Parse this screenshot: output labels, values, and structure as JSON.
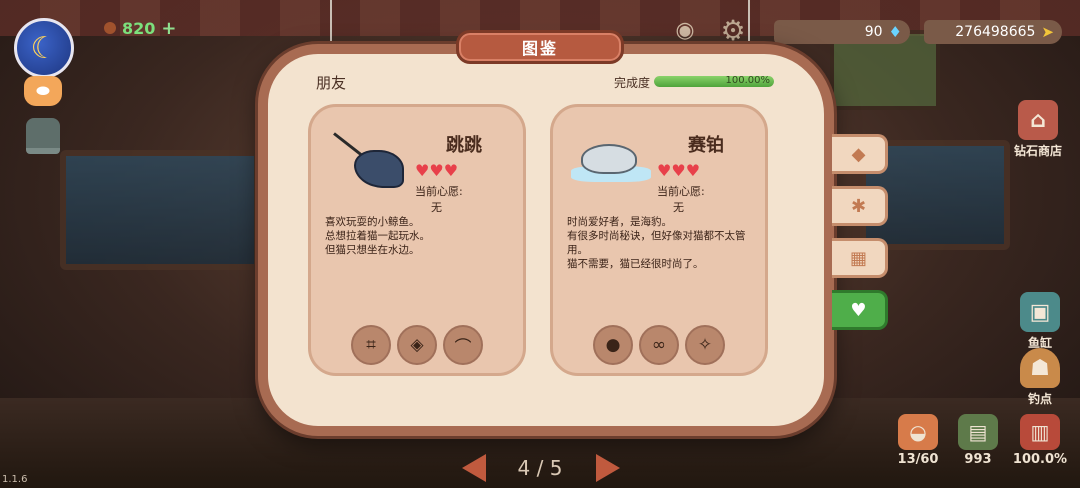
{
  "hud": {
    "coins": "820",
    "coins_plus": "+",
    "gems": "90",
    "fish_currency": "276498665"
  },
  "icons": {
    "moon": "☾",
    "cat": "⬬",
    "eye": "◉",
    "gear": "⚙",
    "gem": "♦",
    "fish": "➤",
    "heart": "♥"
  },
  "panel": {
    "title": "图鉴",
    "category": "朋友",
    "progress_label": "完成度",
    "progress_text": "100.00%",
    "progress_fraction": 1.0
  },
  "cards": [
    {
      "name": "跳跳",
      "hearts": "♥♥♥",
      "wish_label": "当前心愿:",
      "wish_value": "无",
      "description": [
        "喜欢玩耍的小鲸鱼。",
        "总想拉着猫一起玩水。",
        "但猫只想坐在水边。"
      ],
      "items": [
        "net-icon",
        "mirror-icon",
        "hammock-icon"
      ],
      "item_glyphs": [
        "⌗",
        "◈",
        "⌒"
      ]
    },
    {
      "name": "赛铂",
      "hearts": "♥♥♥",
      "wish_label": "当前心愿:",
      "wish_value": "无",
      "description": [
        "时尚爱好者，是海豹。",
        "有很多时尚秘诀，但好像对猫都不太管",
        "用。",
        "猫不需要，猫已经很时尚了。"
      ],
      "items": [
        "seal-icon",
        "sunglasses-icon",
        "charm-icon"
      ],
      "item_glyphs": [
        "●",
        "∞",
        "✧"
      ]
    }
  ],
  "tabs": [
    {
      "name": "fish-tab-icon",
      "glyph": "◆"
    },
    {
      "name": "fish-skeleton-tab-icon",
      "glyph": "✱"
    },
    {
      "name": "boxes-tab-icon",
      "glyph": "▦"
    },
    {
      "name": "friend-tab-icon",
      "glyph": "♥"
    }
  ],
  "side_menu": {
    "shop_label": "钻石商店",
    "tank_label": "鱼缸",
    "fish_point_label": "钓点"
  },
  "bottom": {
    "basket_count": "13/60",
    "bag_count": "993",
    "book_percent": "100.0%"
  },
  "pagination": {
    "text": "4 / 5"
  },
  "version": "1.1.6",
  "colors": {
    "accent": "#b65a40",
    "progress": "#4fa33b",
    "heart": "#e8404a",
    "active_tab": "#4fae4a"
  }
}
